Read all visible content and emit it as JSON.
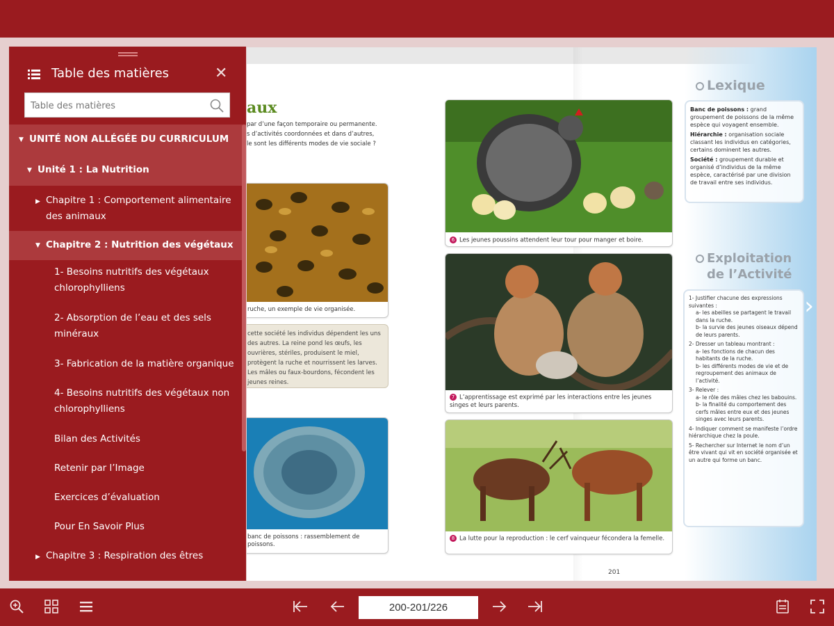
{
  "toc": {
    "title": "Table des matières",
    "search_placeholder": "Table des matières",
    "items": [
      {
        "label": "UNITÉ NON ALLÉGÉE DU CURRICULUM",
        "expanded": true
      },
      {
        "label": "Unité 1 : La Nutrition",
        "expanded": true
      },
      {
        "label": "Chapitre 1 : Comportement alimentaire des animaux",
        "expanded": false
      },
      {
        "label": "Chapitre 2 : Nutrition des végétaux",
        "expanded": true
      },
      {
        "label": "1- Besoins nutritifs des végétaux chlorophylliens"
      },
      {
        "label": "2- Absorption de l’eau et des sels minéraux"
      },
      {
        "label": "3- Fabrication de la matière organique"
      },
      {
        "label": "4- Besoins nutritifs des végétaux non chlorophylliens"
      },
      {
        "label": "Bilan des Activités"
      },
      {
        "label": "Retenir par l’Image"
      },
      {
        "label": "Exercices d’évaluation"
      },
      {
        "label": "Pour En Savoir Plus"
      },
      {
        "label": "Chapitre 3 : Respiration des êtres",
        "expanded": false
      }
    ]
  },
  "book": {
    "left_heading": "aux",
    "intro_lines": [
      "par d’une façon temporaire ou permanente.",
      "s d’activités coordonnées et dans d’autres,",
      "le sont les différents modes de vie sociale ?"
    ],
    "caption_bees": "ruche, un exemple de vie organisée.",
    "note_text": "cette société les individus dépendent les uns des autres. La reine pond les œufs, les ouvrières, stériles, produisent le miel, protègent la ruche et nourrissent les larves. Les mâles ou faux-bourdons, fécondent les jeunes reines.",
    "caption_fish": "banc de poissons : rassemblement de poissons.",
    "caption_hen": "Les jeunes poussins attendent leur tour pour manger et boire.",
    "caption_monkeys": "L’apprentissage est exprimé par les interactions entre les jeunes singes et leurs parents.",
    "caption_deer": "La lutte pour la reproduction : le cerf vainqueur fécondera la femelle.",
    "num_hen": "6",
    "num_monkeys": "7",
    "num_deer": "8",
    "lexique_title": "Lexique",
    "lexique": [
      {
        "term": "Banc de poissons :",
        "def": "grand groupement de poissons de la même espèce qui voyagent ensemble."
      },
      {
        "term": "Hiérarchie :",
        "def": "organisation sociale classant les individus en catégories, certains dominent les autres."
      },
      {
        "term": "Société :",
        "def": "groupement durable et organisé d’individus de la même espèce, caractérisé par une division de travail entre ses individus."
      }
    ],
    "exploitation_title_1": "Exploitation",
    "exploitation_title_2": "de l’Activité",
    "exploitation": [
      "1- Justifier chacune des expressions suivantes :",
      "a- les abeilles se partagent le travail dans la ruche.",
      "b- la survie des jeunes oiseaux dépend de leurs parents.",
      "2- Dresser un tableau montrant :",
      "a- les fonctions de chacun des habitants de la ruche.",
      "b- les différents modes de vie et de regroupement des animaux de l’activité.",
      "3- Relever :",
      "a- le rôle des mâles chez les babouins.",
      "b- la finalité du comportement des cerfs mâles entre eux et des jeunes singes avec leurs parents.",
      "4- Indiquer comment se manifeste l’ordre hiérarchique chez la poule.",
      "5- Rechercher sur Internet le nom d’un être vivant qui vit en société organisée et un autre qui forme un banc."
    ],
    "page_number": "201"
  },
  "toolbar": {
    "page_indicator": "200-201/226",
    "icons": [
      "zoom-icon",
      "grid-icon",
      "list-icon",
      "first-page-icon",
      "previous-page-icon",
      "next-page-icon",
      "last-page-icon",
      "notes-icon",
      "fullscreen-icon"
    ]
  },
  "colors": {
    "brand": "#9a1b1f",
    "highlight": "#ac3a3d",
    "heading_green": "#5a8a1f",
    "caption_number": "#c2185b"
  }
}
